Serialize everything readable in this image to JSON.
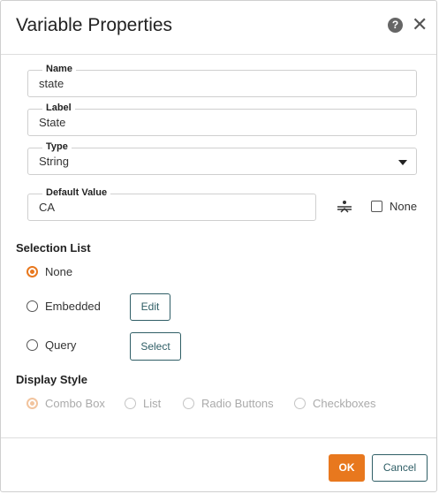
{
  "dialog": {
    "title": "Variable Properties",
    "help_icon": "question-circle-icon",
    "close_icon": "close-icon",
    "close_glyph": "✕",
    "help_glyph": "?"
  },
  "fields": {
    "name": {
      "label": "Name",
      "value": "state"
    },
    "label": {
      "label": "Label",
      "value": "State"
    },
    "type": {
      "label": "Type",
      "value": "String"
    },
    "default_value": {
      "label": "Default Value",
      "value": "CA",
      "none_label": "None",
      "none_checked": false
    }
  },
  "selection_list": {
    "heading": "Selection List",
    "options": [
      {
        "label": "None",
        "selected": true
      },
      {
        "label": "Embedded",
        "selected": false,
        "button": "Edit"
      },
      {
        "label": "Query",
        "selected": false,
        "button": "Select"
      }
    ]
  },
  "display_style": {
    "heading": "Display Style",
    "options": [
      {
        "label": "Combo Box",
        "selected": true
      },
      {
        "label": "List",
        "selected": false
      },
      {
        "label": "Radio Buttons",
        "selected": false
      },
      {
        "label": "Checkboxes",
        "selected": false
      }
    ],
    "disabled": true
  },
  "footer": {
    "ok": "OK",
    "cancel": "Cancel"
  },
  "colors": {
    "accent": "#e8781e",
    "secondary": "#2f5e66"
  }
}
